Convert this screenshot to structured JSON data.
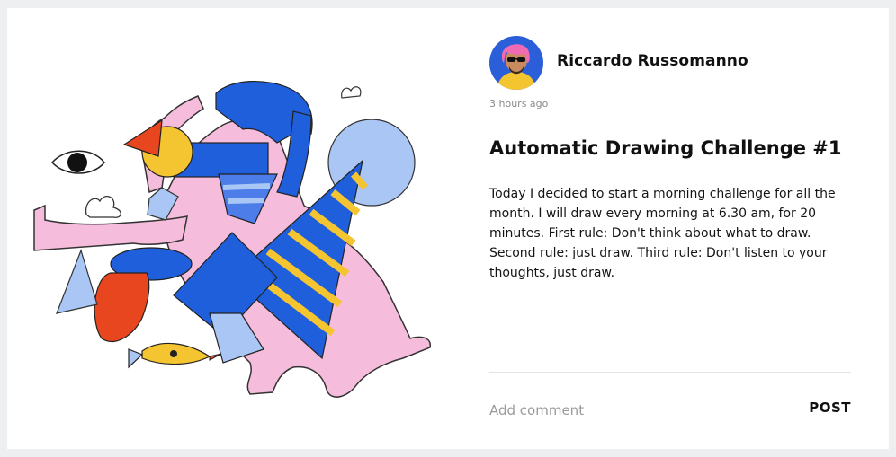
{
  "post": {
    "author_name": "Riccardo Russomanno",
    "timestamp": "3 hours ago",
    "title": "Automatic Drawing Challenge #1",
    "body": "Today I decided to start a morning challenge for all the month. I will draw every morning at 6.30 am, for 20 minutes. First rule: Don't think about what to draw. Second rule: just draw. Third rule: Don't listen to your thoughts, just draw.",
    "image_icon": "abstract-illustration",
    "avatar_icon": "user-avatar"
  },
  "comment": {
    "placeholder": "Add comment",
    "value": "",
    "post_label": "POST"
  },
  "colors": {
    "pink": "#f6bcdc",
    "blue": "#1f5fdc",
    "yellow": "#f5c431",
    "red": "#e8461f",
    "light_blue": "#a9c6f5",
    "page_bg": "#eeeff1"
  }
}
